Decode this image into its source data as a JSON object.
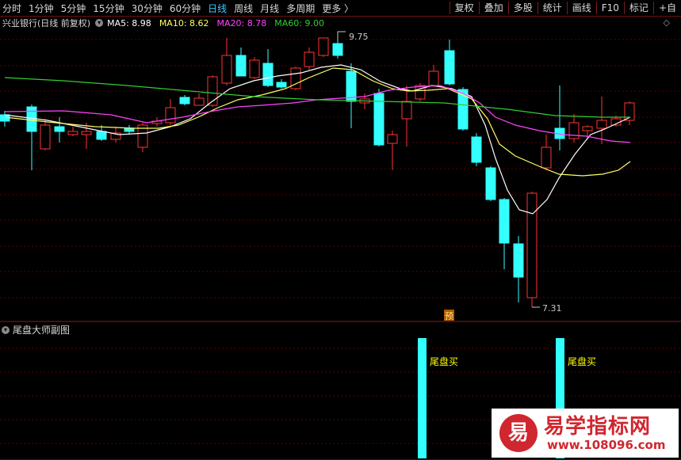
{
  "toolbar": {
    "tabs": [
      "分时",
      "1分钟",
      "5分钟",
      "15分钟",
      "30分钟",
      "60分钟",
      "日线",
      "周线",
      "月线",
      "多周期",
      "更多 〉"
    ],
    "active_tab": "日线",
    "tools": [
      "复权",
      "叠加",
      "多股",
      "统计",
      "画线",
      "F10",
      "标记",
      "+自"
    ]
  },
  "main_chart": {
    "stock_title": "兴业银行(日线 前复权)",
    "ma_legend": [
      {
        "label": "MA5: 8.98",
        "color": "#ffffff"
      },
      {
        "label": "MA10: 8.62",
        "color": "#ffff66"
      },
      {
        "label": "MA20: 8.78",
        "color": "#ff44ff"
      },
      {
        "label": "MA60: 9.00",
        "color": "#33cc33"
      }
    ],
    "high_label": "9.75",
    "low_label": "7.31",
    "forecast_badge": "预",
    "up_color": "#ff3333",
    "down_color": "#33ffff"
  },
  "sub_chart": {
    "title": "尾盘大师副图",
    "signal_label": "尾盘买",
    "signal_color": "#33ffff",
    "label_color": "#ffff00"
  },
  "watermark": {
    "logo_char": "易",
    "name": "易学指标网",
    "url": "www.108096.com"
  },
  "icons": {
    "collapse": "chevron-down-icon",
    "settings": "diamond-icon"
  }
}
